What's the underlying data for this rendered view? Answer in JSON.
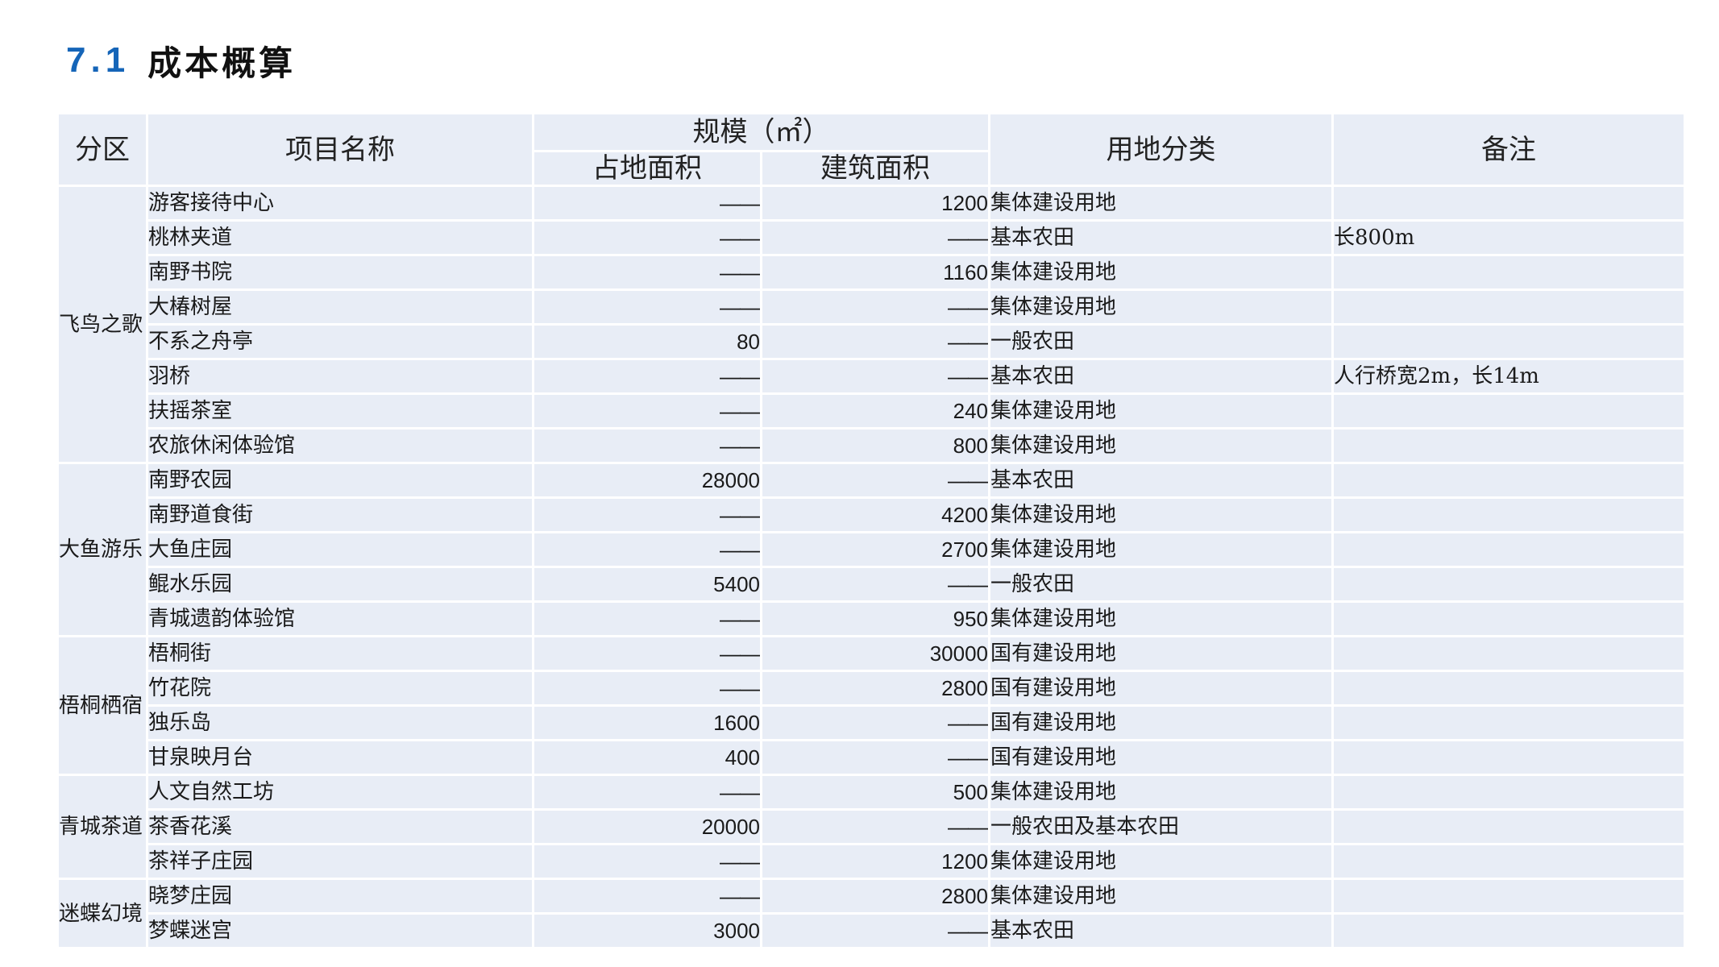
{
  "title": {
    "number": "7.1",
    "text": "成本概算"
  },
  "headers": {
    "zone": "分区",
    "name": "项目名称",
    "scale": "规模（㎡）",
    "land_area": "占地面积",
    "build_area": "建筑面积",
    "land_class": "用地分类",
    "note": "备注"
  },
  "groups": [
    {
      "zone": "飞鸟之歌",
      "rows": [
        {
          "name": "游客接待中心",
          "land_area": "——",
          "build_area": "1200",
          "land_class": "集体建设用地",
          "note": ""
        },
        {
          "name": "桃林夹道",
          "land_area": "——",
          "build_area": "——",
          "land_class": "基本农田",
          "note": "长800m"
        },
        {
          "name": "南野书院",
          "land_area": "——",
          "build_area": "1160",
          "land_class": "集体建设用地",
          "note": ""
        },
        {
          "name": "大椿树屋",
          "land_area": "——",
          "build_area": "——",
          "land_class": "集体建设用地",
          "note": ""
        },
        {
          "name": "不系之舟亭",
          "land_area": "80",
          "build_area": "——",
          "land_class": "一般农田",
          "note": ""
        },
        {
          "name": "羽桥",
          "land_area": "——",
          "build_area": "——",
          "land_class": "基本农田",
          "note": "人行桥宽2m，长14m"
        },
        {
          "name": "扶摇茶室",
          "land_area": "——",
          "build_area": "240",
          "land_class": "集体建设用地",
          "note": ""
        },
        {
          "name": "农旅休闲体验馆",
          "land_area": "——",
          "build_area": "800",
          "land_class": "集体建设用地",
          "note": ""
        }
      ]
    },
    {
      "zone": "大鱼游乐",
      "rows": [
        {
          "name": "南野农园",
          "land_area": "28000",
          "build_area": "——",
          "land_class": "基本农田",
          "note": ""
        },
        {
          "name": "南野道食街",
          "land_area": "——",
          "build_area": "4200",
          "land_class": "集体建设用地",
          "note": ""
        },
        {
          "name": "大鱼庄园",
          "land_area": "——",
          "build_area": "2700",
          "land_class": "集体建设用地",
          "note": ""
        },
        {
          "name": "鲲水乐园",
          "land_area": "5400",
          "build_area": "——",
          "land_class": "一般农田",
          "note": ""
        },
        {
          "name": "青城遗韵体验馆",
          "land_area": "——",
          "build_area": "950",
          "land_class": "集体建设用地",
          "note": ""
        }
      ]
    },
    {
      "zone": "梧桐栖宿",
      "rows": [
        {
          "name": "梧桐街",
          "land_area": "——",
          "build_area": "30000",
          "land_class": "国有建设用地",
          "note": ""
        },
        {
          "name": "竹花院",
          "land_area": "——",
          "build_area": "2800",
          "land_class": "国有建设用地",
          "note": ""
        },
        {
          "name": "独乐岛",
          "land_area": "1600",
          "build_area": "——",
          "land_class": "国有建设用地",
          "note": ""
        },
        {
          "name": "甘泉映月台",
          "land_area": "400",
          "build_area": "——",
          "land_class": "国有建设用地",
          "note": ""
        }
      ]
    },
    {
      "zone": "青城茶道",
      "rows": [
        {
          "name": "人文自然工坊",
          "land_area": "——",
          "build_area": "500",
          "land_class": "集体建设用地",
          "note": ""
        },
        {
          "name": "茶香花溪",
          "land_area": "20000",
          "build_area": "——",
          "land_class": "一般农田及基本农田",
          "note": ""
        },
        {
          "name": "茶祥子庄园",
          "land_area": "——",
          "build_area": "1200",
          "land_class": "集体建设用地",
          "note": ""
        }
      ]
    },
    {
      "zone": "迷蝶幻境",
      "rows": [
        {
          "name": "晓梦庄园",
          "land_area": "——",
          "build_area": "2800",
          "land_class": "集体建设用地",
          "note": ""
        },
        {
          "name": "梦蝶迷宫",
          "land_area": "3000",
          "build_area": "——",
          "land_class": "基本农田",
          "note": ""
        }
      ]
    }
  ]
}
